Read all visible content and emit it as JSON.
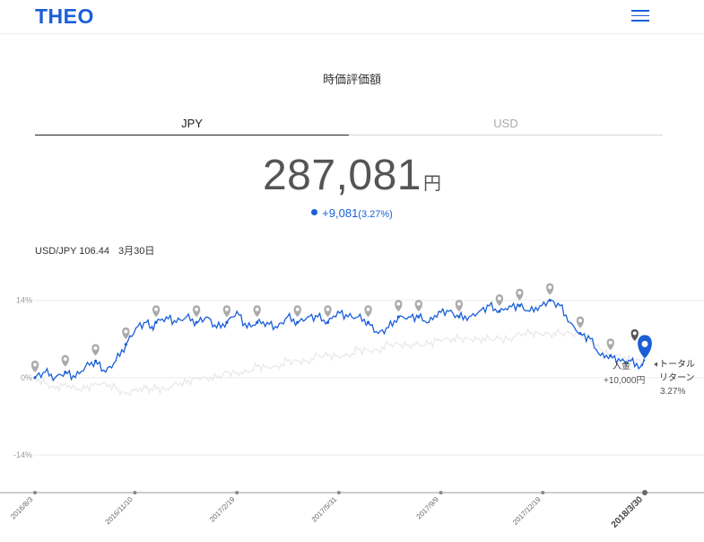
{
  "header": {
    "logo": "THEO",
    "menu_icon": "hamburger-menu-icon"
  },
  "section_title": "時価評価額",
  "tabs": [
    {
      "label": "JPY",
      "active": true
    },
    {
      "label": "USD",
      "active": false
    }
  ],
  "valuation": {
    "amount": "287,081",
    "unit": "円",
    "change": "+9,081",
    "change_pct": "(3.27%)"
  },
  "fx": {
    "label": "USD/JPY 106.44",
    "date": "3月30日"
  },
  "colors": {
    "brand": "#1a5fd8",
    "series_primary": "#1a5fd8",
    "series_benchmark": "#e6e6ec",
    "marker": "#aaaaaa"
  },
  "chart_data": {
    "type": "line",
    "y_ticks": [
      "14%",
      "0%",
      "-14%"
    ],
    "y_tick_values": [
      14,
      0,
      -14
    ],
    "ylim": [
      -20,
      18
    ],
    "x_tick_labels": [
      "2016/8/3",
      "2016/11/10",
      "2017/2/19",
      "2017/5/31",
      "2017/9/9",
      "2017/12/19",
      "2018/3/30"
    ],
    "x_tick_values": [
      0,
      99,
      200,
      301,
      402,
      503,
      604
    ],
    "xlim": [
      0,
      604
    ],
    "series": [
      {
        "x": [
          0,
          10,
          20,
          30,
          40,
          50,
          60,
          70,
          80,
          90,
          100,
          110,
          115,
          120,
          130,
          140,
          150,
          160,
          170,
          180,
          190,
          200,
          210,
          220,
          230,
          240,
          250,
          260,
          270,
          280,
          290,
          300,
          310,
          320,
          330,
          340,
          350,
          360,
          370,
          380,
          390,
          400,
          410,
          420,
          430,
          440,
          450,
          460,
          470,
          480,
          490,
          500,
          510,
          520,
          530,
          540,
          550,
          560,
          570,
          580,
          590,
          600,
          604
        ],
        "values": [
          0,
          1,
          0,
          1,
          0,
          2,
          3,
          1,
          3,
          6,
          9,
          10,
          9,
          10,
          11,
          10,
          11,
          10,
          11,
          9,
          10,
          12,
          9,
          10,
          10,
          9,
          11,
          10,
          11,
          11,
          10,
          12,
          11,
          11,
          10,
          8,
          9,
          11,
          11,
          11,
          10,
          12,
          12,
          11,
          11,
          12,
          13,
          12,
          13,
          13,
          12,
          13,
          14,
          13,
          10,
          8,
          7,
          4,
          4,
          3,
          3,
          2,
          3
        ]
      },
      {
        "x": [
          0,
          10,
          20,
          30,
          40,
          50,
          60,
          70,
          80,
          90,
          100,
          110,
          115,
          120,
          130,
          140,
          150,
          160,
          170,
          180,
          190,
          200,
          210,
          220,
          230,
          240,
          250,
          260,
          270,
          280,
          290,
          300,
          310,
          320,
          330,
          340,
          350,
          360,
          370,
          380,
          390,
          400,
          410,
          420,
          430,
          440,
          450,
          460,
          470,
          480,
          490,
          500,
          510,
          520,
          530,
          540,
          550,
          560,
          570,
          580,
          590,
          600,
          604
        ],
        "values": [
          0,
          -1,
          -2,
          -1,
          -2,
          -2,
          -1,
          -1,
          -2,
          -3,
          -2,
          -2,
          -2,
          -2,
          -2,
          -1,
          -1,
          0,
          0,
          0,
          1,
          1,
          1,
          2,
          2,
          2,
          3,
          3,
          3,
          4,
          4,
          4,
          4,
          5,
          5,
          5,
          6,
          6,
          6,
          6,
          6,
          7,
          7,
          7,
          7,
          7,
          7,
          7,
          7,
          8,
          8,
          8,
          8,
          8,
          8,
          8,
          7,
          5,
          4,
          4,
          3,
          3,
          3
        ]
      }
    ],
    "annotations": [
      {
        "label": "入金",
        "value": "+10,000円"
      },
      {
        "label": "トータル",
        "label2": "リターン",
        "value": "3.27%"
      }
    ],
    "grid": true
  }
}
